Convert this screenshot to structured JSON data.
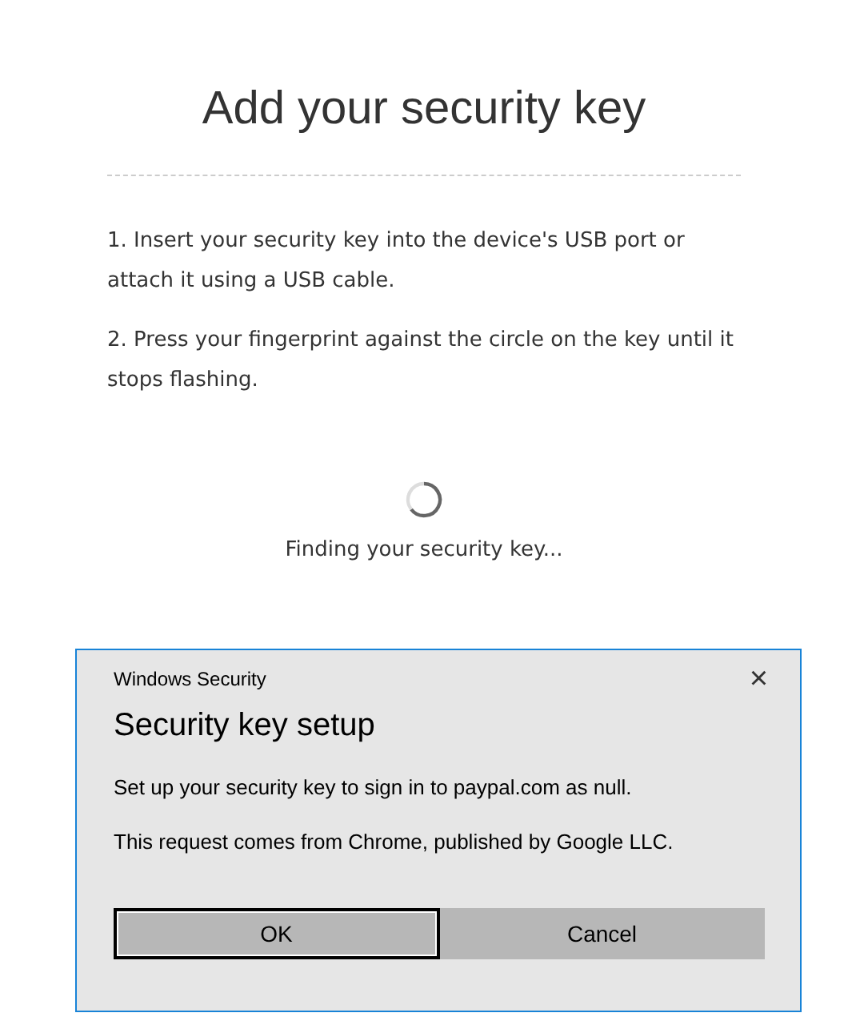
{
  "page": {
    "title": "Add your security key",
    "steps": [
      "1. Insert your security key into the device's USB port or attach it using a USB cable.",
      "2. Press your fingerprint against the circle on the key until it stops flashing."
    ],
    "status": "Finding your security key..."
  },
  "dialog": {
    "caption": "Windows Security",
    "close": "×",
    "title": "Security key setup",
    "messages": [
      "Set up your security key to sign in to paypal.com as null.",
      "This request comes from Chrome, published by Google LLC."
    ],
    "buttons": [
      {
        "label": "OK",
        "focused": true
      },
      {
        "label": "Cancel",
        "focused": false
      }
    ]
  }
}
